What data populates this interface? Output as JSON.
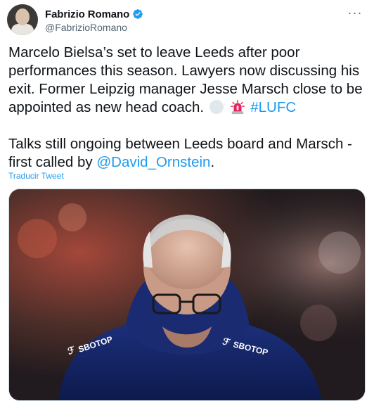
{
  "author": {
    "name": "Fabrizio Romano",
    "handle": "@FabrizioRomano",
    "verified": true
  },
  "more_icon": "more-horizontal-icon",
  "tweet": {
    "para1_text": "Marcelo Bielsa’s set to leave Leeds after poor performances this season. Lawyers now discussing his exit. Former Leipzig manager Jesse Marsch close to be appointed as new head coach.",
    "hashtag": "#LUFC",
    "para2_text": "Talks still ongoing between Leeds board and Marsch - first called by",
    "mention": "@David_Ornstein",
    "para2_end": "."
  },
  "translate_label": "Traducir Tweet",
  "media": {
    "jersey_text_left": "SBOTOP",
    "jersey_text_right": "SBOTOP"
  },
  "colors": {
    "link": "#1d9bf0",
    "secondary_text": "#536471",
    "verified": "#1d9bf0"
  }
}
